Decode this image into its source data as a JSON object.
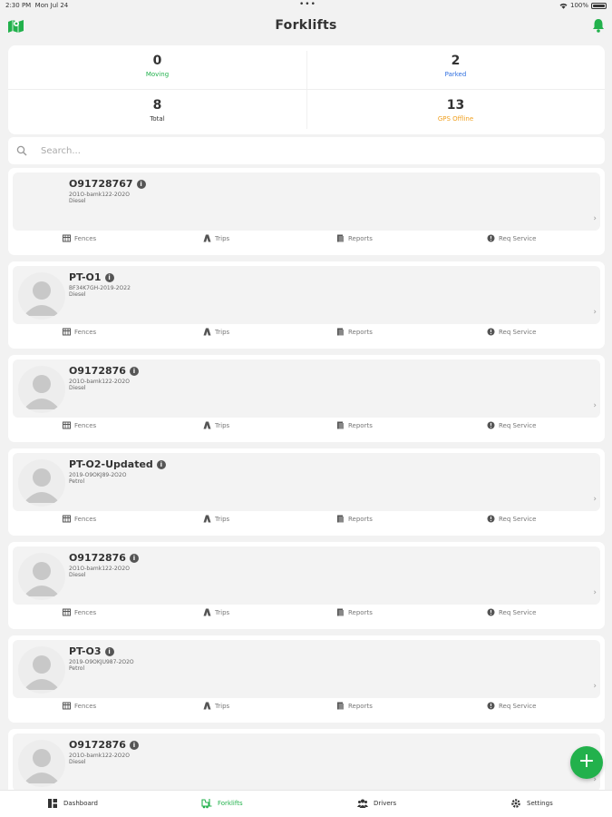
{
  "status_bar": {
    "time": "2:30 PM",
    "date": "Mon Jul 24",
    "dots": "•••",
    "battery": "100%"
  },
  "header": {
    "title": "Forklifts",
    "left_icon": "map-icon",
    "right_icon": "bell-icon"
  },
  "stats": {
    "moving": {
      "value": "0",
      "label": "Moving",
      "color": "#22b14c"
    },
    "parked": {
      "value": "2",
      "label": "Parked",
      "color": "#2f6fe0"
    },
    "total": {
      "value": "8",
      "label": "Total",
      "color": "#333333"
    },
    "gps_offline": {
      "value": "13",
      "label": "GPS Offline",
      "color": "#f0a020"
    }
  },
  "search": {
    "placeholder": "Search..."
  },
  "action_labels": {
    "fences": "Fences",
    "trips": "Trips",
    "reports": "Reports",
    "req_service": "Req Service"
  },
  "forklifts": [
    {
      "name": "O91728767",
      "line1": "2O1O-bamk122-2O2O",
      "line2": "Diesel",
      "avatar": false
    },
    {
      "name": "PT-O1",
      "line1": "BF34K7GH-2019-2O22",
      "line2": "Diesel",
      "avatar": true
    },
    {
      "name": "O9172876",
      "line1": "2O1O-bamk122-2O2O",
      "line2": "Diesel",
      "avatar": true
    },
    {
      "name": "PT-O2-Updated",
      "line1": "2019-O9OKJ89-2O2O",
      "line2": "Petrol",
      "avatar": true
    },
    {
      "name": "O9172876",
      "line1": "2O1O-bamk122-2O2O",
      "line2": "Diesel",
      "avatar": true
    },
    {
      "name": "PT-O3",
      "line1": "2019-O9OKJU987-2O2O",
      "line2": "Petrol",
      "avatar": true
    },
    {
      "name": "O9172876",
      "line1": "2O1O-bamk122-2O2O",
      "line2": "Diesel",
      "avatar": true
    }
  ],
  "fab": {
    "label": "+"
  },
  "tabs": [
    {
      "label": "Dashboard",
      "icon": "dashboard-icon",
      "active": false
    },
    {
      "label": "Forklifts",
      "icon": "forklift-icon",
      "active": true
    },
    {
      "label": "Drivers",
      "icon": "drivers-icon",
      "active": false
    },
    {
      "label": "Settings",
      "icon": "settings-icon",
      "active": false
    }
  ],
  "colors": {
    "accent": "#22b14c",
    "background": "#f2f2f2"
  }
}
